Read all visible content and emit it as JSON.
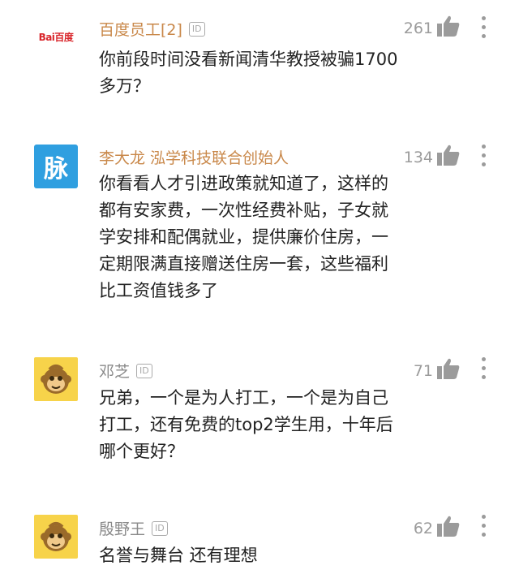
{
  "comments": [
    {
      "username": "百度员工[2]",
      "badge": "ID",
      "likes": "261",
      "text": "你前段时间没看新闻清华教授被骗1700\n多万？",
      "avatar_text": "Bai百度"
    },
    {
      "username": "李大龙 泓学科技联合创始人",
      "likes": "134",
      "text": "你看看人才引进政策就知道了，这样的\n都有安家费，一次性经费补贴，子女就\n学安排和配偶就业，提供廉价住房，一\n定期限满直接赠送住房一套，这些福利\n比工资值钱多了",
      "avatar_text": "脉"
    },
    {
      "username": "邓芝",
      "badge": "ID",
      "likes": "71",
      "text": "兄弟，一个是为人打工，一个是为自己\n打工，还有免费的top2学生用，十年后\n哪个更好？"
    },
    {
      "username": "殷野王",
      "badge": "ID",
      "likes": "62",
      "text": "名誉与舞台 还有理想"
    }
  ],
  "colors": {
    "username_orange": "#c9884a",
    "username_grey": "#8a8a8a",
    "text": "#222222",
    "icon_grey": "#9b9b9b"
  },
  "icons": [
    "thumbs-up-icon",
    "more-vertical-icon",
    "monkey-avatar-icon"
  ]
}
